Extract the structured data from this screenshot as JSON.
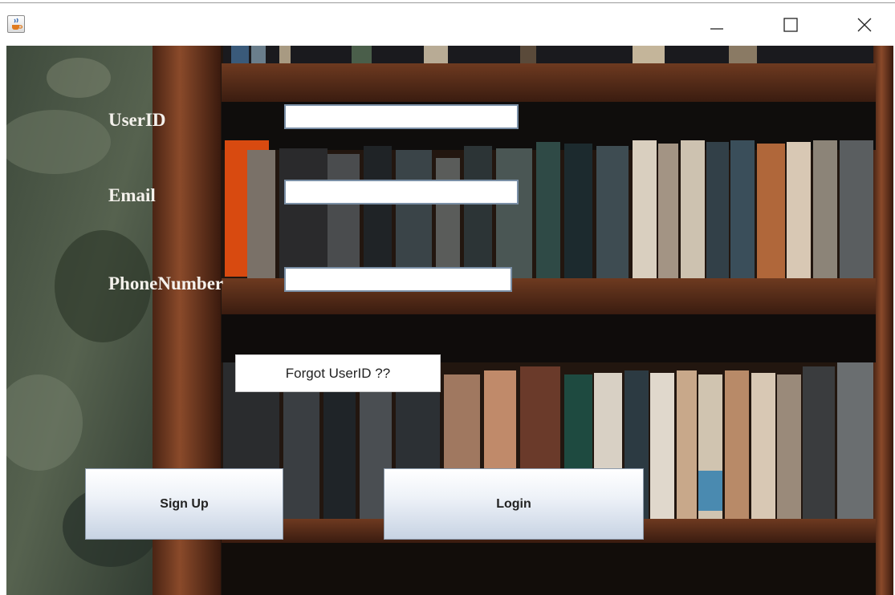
{
  "window": {
    "icons": {
      "app": "java-cup-icon",
      "minimize": "minimize-icon",
      "maximize": "maximize-icon",
      "close": "close-icon"
    }
  },
  "form": {
    "userid_label": "UserID",
    "email_label": "Email",
    "phone_label": "PhoneNumber",
    "userid_value": "",
    "email_value": "",
    "phone_value": ""
  },
  "buttons": {
    "forgot_label": "Forgot UserID ??",
    "signup_label": "Sign Up",
    "login_label": "Login"
  },
  "colors": {
    "label_text": "#f4f1ec",
    "button_gradient_bottom": "#c7d3e3",
    "field_border": "#7a8fa6"
  }
}
